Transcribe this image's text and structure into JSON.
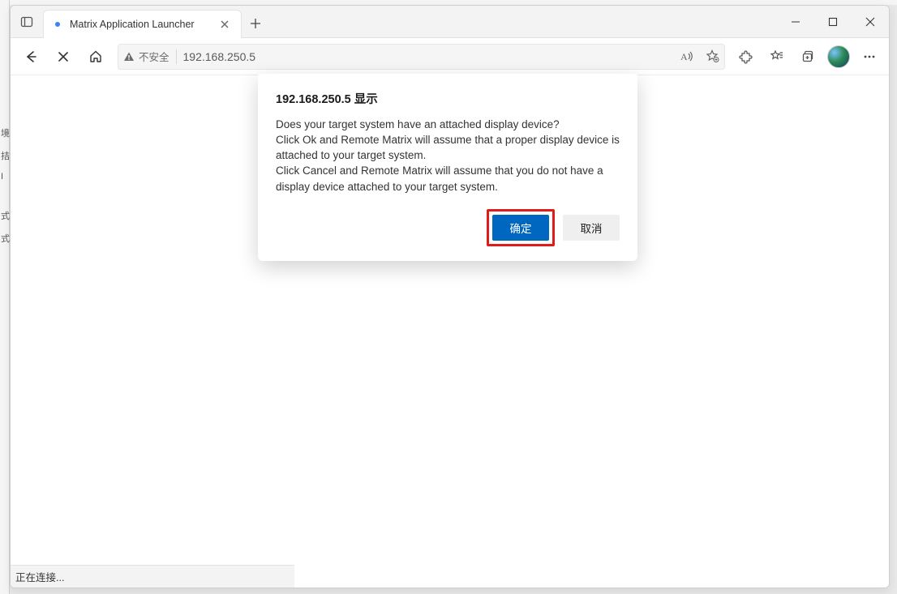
{
  "tab": {
    "title": "Matrix Application Launcher"
  },
  "address_bar": {
    "security_label": "不安全",
    "url": "192.168.250.5"
  },
  "dialog": {
    "title": "192.168.250.5 显示",
    "message": "Does your target system have an attached display device?\nClick Ok and Remote Matrix will assume that a proper display device is attached to your target system.\nClick Cancel and Remote Matrix will assume that you do not have a display device attached to your target system.",
    "ok_label": "确定",
    "cancel_label": "取消"
  },
  "status_bar": {
    "text": "正在连接..."
  },
  "sidebar_peek": {
    "items": [
      "境",
      "拮",
      "I",
      "",
      "式",
      "式"
    ]
  }
}
